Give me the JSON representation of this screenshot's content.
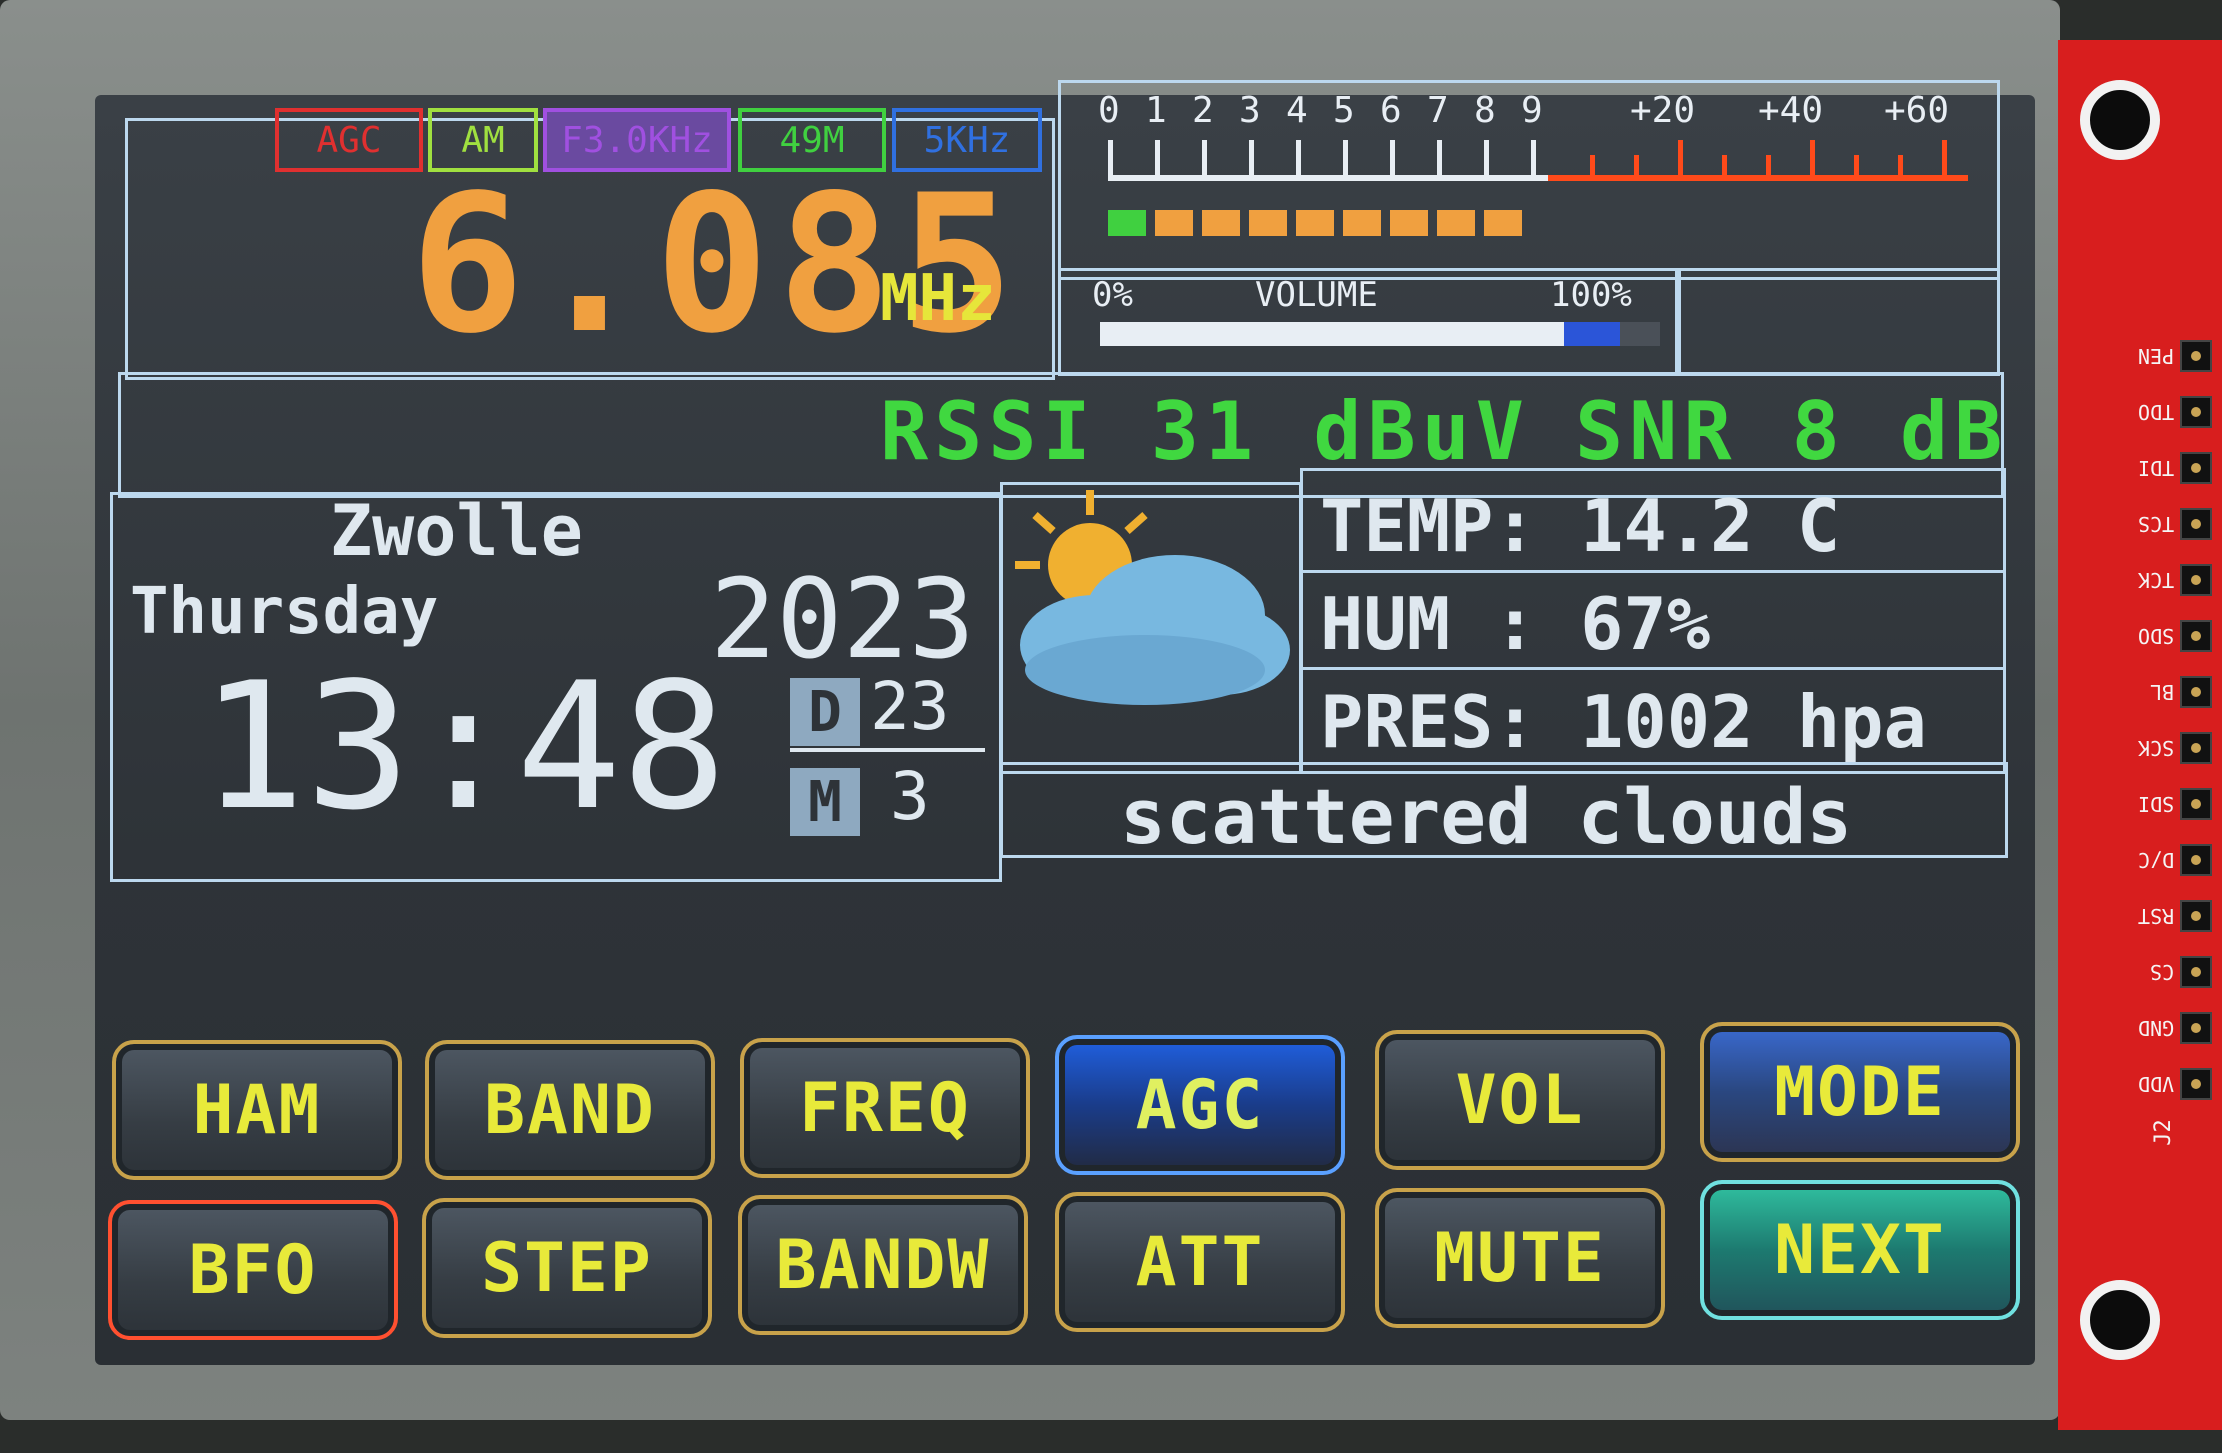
{
  "indicators": [
    {
      "label": "AGC",
      "color": "#e03030"
    },
    {
      "label": "AM",
      "color": "#a0e040"
    },
    {
      "label": "F3.0KHz",
      "color": "#a050e0"
    },
    {
      "label": "49M",
      "color": "#40d040"
    },
    {
      "label": "5KHz",
      "color": "#3070e0"
    }
  ],
  "frequency": {
    "value": "6.085",
    "unit": "MHz"
  },
  "smeter": {
    "scale": [
      "0",
      "1",
      "2",
      "3",
      "4",
      "5",
      "6",
      "7",
      "8",
      "9",
      "+20",
      "+40",
      "+60"
    ],
    "level_segments": 9
  },
  "volume": {
    "min_label": "0%",
    "title": "VOLUME",
    "max_label": "100%",
    "level": 0.92
  },
  "signal": {
    "rssi": "RSSI 31 dBuV",
    "snr": "SNR 8 dB"
  },
  "clock": {
    "city": "Zwolle",
    "weekday": "Thursday",
    "year": "2023",
    "time": "13:48",
    "day_label": "D",
    "day": "23",
    "month_label": "M",
    "month": "3"
  },
  "weather": {
    "icon": "partly-cloudy-icon",
    "temp": "TEMP: 14.2 C",
    "hum": "HUM  : 67%",
    "pres": "PRES: 1002 hpa",
    "description": "scattered clouds"
  },
  "buttons": {
    "row1": [
      "HAM",
      "BAND",
      "FREQ",
      "AGC",
      "VOL",
      "MODE"
    ],
    "row2": [
      "BFO",
      "STEP",
      "BANDW",
      "ATT",
      "MUTE",
      "NEXT"
    ]
  },
  "header_pins": [
    "PEN",
    "TDO",
    "TDI",
    "TCS",
    "TCK",
    "SDO",
    "BL",
    "SCK",
    "SDI",
    "D/C",
    "RST",
    "CS",
    "GND",
    "VDD"
  ],
  "connector_label": "J2"
}
